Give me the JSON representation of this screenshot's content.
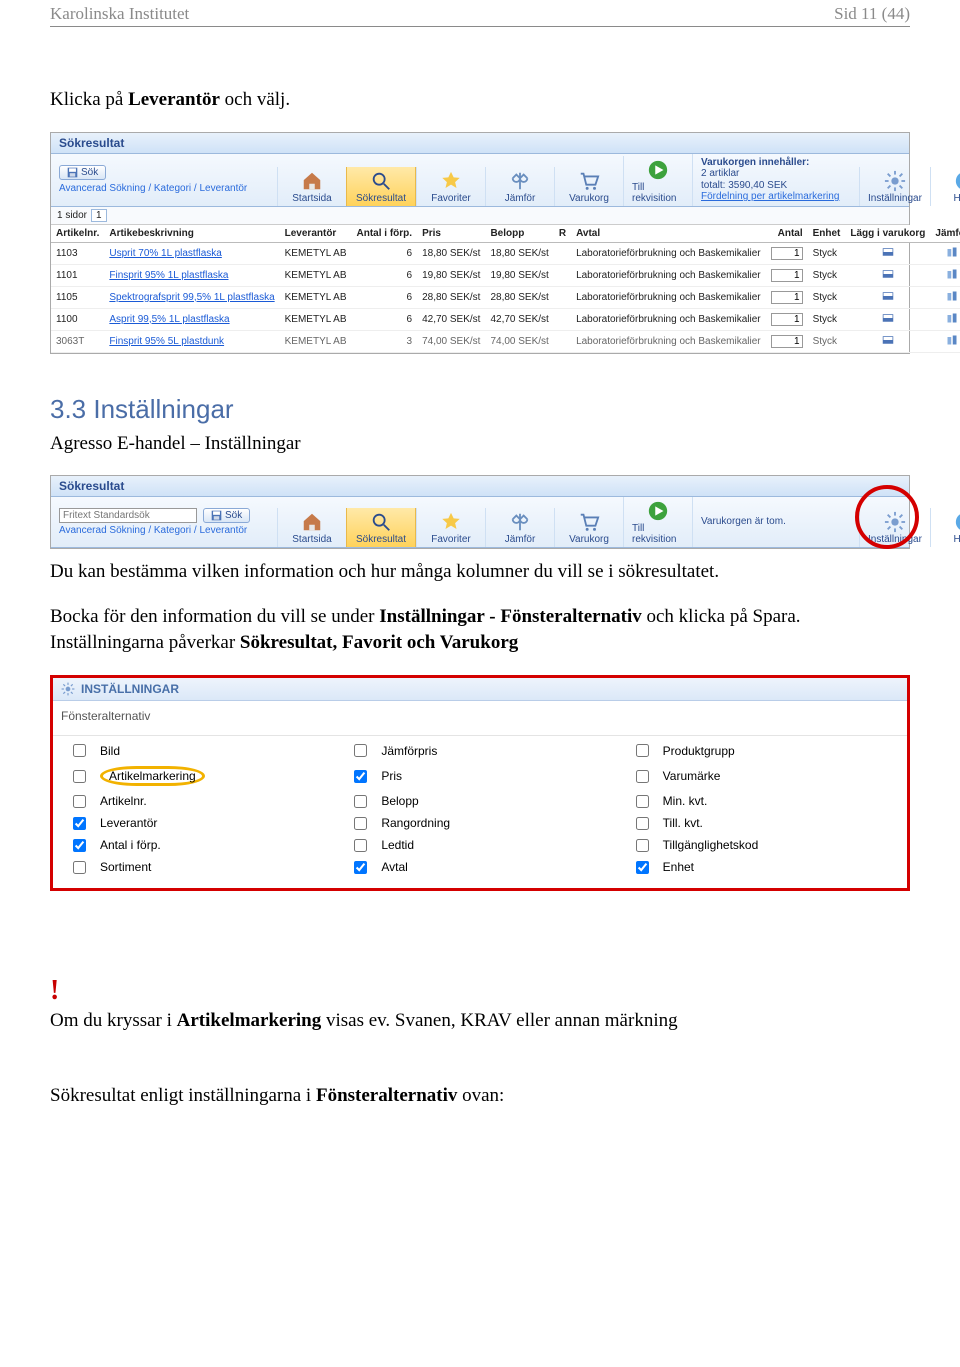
{
  "header": {
    "left": "Karolinska Institutet",
    "right": "Sid 11 (44)"
  },
  "intro": {
    "pre": "Klicka på ",
    "bold": "Leverantör",
    "post": " och välj."
  },
  "shot1": {
    "title": "Sökresultat",
    "sokBtn": "Sök",
    "breadcrumbs": "Avancerad Sökning  /  Kategori  /  Leverantör",
    "tools": {
      "start": "Startsida",
      "sokres": "Sökresultat",
      "fav": "Favoriter",
      "jamfor": "Jämför",
      "varukorg": "Varukorg",
      "tillrekv": "Till rekvisition",
      "install": "Inställningar",
      "hjalp": "Hjälp"
    },
    "cart": {
      "hdr": "Varukorgen innehåller:",
      "l1": "2 artiklar",
      "l2": "totalt: 3590,40 SEK",
      "link": "Fördelning per artikelmarkering"
    },
    "pager": {
      "label": "1 sidor",
      "page": "1"
    },
    "cols": {
      "artnr": "Artikelnr.",
      "beskr": "Artikebeskrivning",
      "lev": "Leverantör",
      "aif": "Antal i förp.",
      "pris": "Pris",
      "belopp": "Belopp",
      "r": "R",
      "avtal": "Avtal",
      "antal": "Antal",
      "enhet": "Enhet",
      "lagg": "Lägg i varukorg",
      "jamfor": "Jämför"
    },
    "rows": [
      {
        "nr": "1103",
        "beskr": "Usprit 70% 1L plastflaska",
        "lev": "KEMETYL AB",
        "aif": "6",
        "pris": "18,80 SEK/st",
        "belopp": "18,80 SEK/st",
        "avtal": "Laboratorieförbrukning och Baskemikalier",
        "antal": "1",
        "enhet": "Styck"
      },
      {
        "nr": "1101",
        "beskr": "Finsprit 95% 1L plastflaska",
        "lev": "KEMETYL AB",
        "aif": "6",
        "pris": "19,80 SEK/st",
        "belopp": "19,80 SEK/st",
        "avtal": "Laboratorieförbrukning och Baskemikalier",
        "antal": "1",
        "enhet": "Styck"
      },
      {
        "nr": "1105",
        "beskr": "Spektrografsprit 99,5% 1L plastflaska",
        "lev": "KEMETYL AB",
        "aif": "6",
        "pris": "28,80 SEK/st",
        "belopp": "28,80 SEK/st",
        "avtal": "Laboratorieförbrukning och Baskemikalier",
        "antal": "1",
        "enhet": "Styck"
      },
      {
        "nr": "1100",
        "beskr": "Asprit 99,5% 1L plastflaska",
        "lev": "KEMETYL AB",
        "aif": "6",
        "pris": "42,70 SEK/st",
        "belopp": "42,70 SEK/st",
        "avtal": "Laboratorieförbrukning och Baskemikalier",
        "antal": "1",
        "enhet": "Styck"
      },
      {
        "nr": "3063T",
        "beskr": "Finsprit 95% 5L plastdunk",
        "lev": "KEMETYL AB",
        "aif": "3",
        "pris": "74,00 SEK/st",
        "belopp": "74,00 SEK/st",
        "avtal": "Laboratorieförbrukning och Baskemikalier",
        "antal": "1",
        "enhet": "Styck"
      }
    ]
  },
  "section": {
    "h2": "3.3  Inställningar",
    "sub": "Agresso E-handel – Inställningar"
  },
  "shot2": {
    "title": "Sökresultat",
    "fritextPlaceholder": "Fritext Standardsök",
    "sokBtn": "Sök",
    "breadcrumbs": "Avancerad Sökning  /  Kategori  /  Leverantör",
    "tools": {
      "start": "Startsida",
      "sokres": "Sökresultat",
      "fav": "Favoriter",
      "jamfor": "Jämför",
      "varukorg": "Varukorg",
      "tillrekv": "Till rekvisition",
      "install": "Inställningar",
      "hjalp": "Hjälp"
    },
    "empty": "Varukorgen är tom."
  },
  "para2": {
    "text": "Du kan bestämma vilken information och hur många kolumner du vill se i sökresultatet."
  },
  "para3": {
    "a": "Bocka för den information du vill se under ",
    "b": "Inställningar - Fönsteralternativ",
    "c": " och klicka på Spara. Inställningarna påverkar ",
    "d": "Sökresultat, Favorit och Varukorg"
  },
  "settings": {
    "title": "INSTÄLLNINGAR",
    "subtitle": "Fönsteralternativ",
    "options": [
      {
        "label": "Bild",
        "chk": false
      },
      {
        "label": "Jämförpris",
        "chk": false
      },
      {
        "label": "Produktgrupp",
        "chk": false
      },
      {
        "label": "Artikelmarkering",
        "chk": false,
        "ring": true
      },
      {
        "label": "Pris",
        "chk": true
      },
      {
        "label": "Varumärke",
        "chk": false
      },
      {
        "label": "Artikelnr.",
        "chk": false
      },
      {
        "label": "Belopp",
        "chk": false
      },
      {
        "label": "Min. kvt.",
        "chk": false
      },
      {
        "label": "Leverantör",
        "chk": true
      },
      {
        "label": "Rangordning",
        "chk": false
      },
      {
        "label": "Till. kvt.",
        "chk": false
      },
      {
        "label": "Antal i förp.",
        "chk": true
      },
      {
        "label": "Ledtid",
        "chk": false
      },
      {
        "label": "Tillgänglighetskod",
        "chk": false
      },
      {
        "label": "Sortiment",
        "chk": false
      },
      {
        "label": "Avtal",
        "chk": true
      },
      {
        "label": "Enhet",
        "chk": true
      }
    ]
  },
  "para4": {
    "a": "Om du kryssar i ",
    "b": "Artikelmarkering",
    "c": " visas ev. Svanen, KRAV eller annan märkning"
  },
  "para5": {
    "a": "Sökresultat enligt inställningarna i ",
    "b": "Fönsteralternativ",
    "c": " ovan:"
  }
}
